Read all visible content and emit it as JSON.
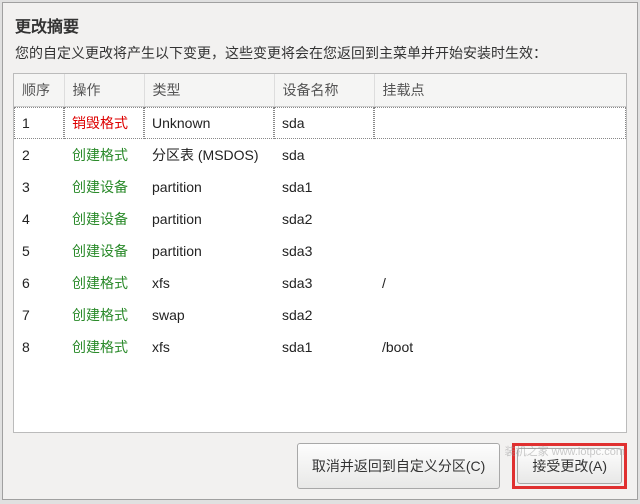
{
  "dialog": {
    "title": "更改摘要",
    "subtitle": "您的自定义更改将产生以下变更，这些变更将会在您返回到主菜单并开始安装时生效："
  },
  "table": {
    "headers": {
      "order": "顺序",
      "operation": "操作",
      "type": "类型",
      "device": "设备名称",
      "mount": "挂载点"
    },
    "rows": [
      {
        "order": "1",
        "op": "销毁格式",
        "op_class": "destroy",
        "type": "Unknown",
        "device": "sda",
        "mount": ""
      },
      {
        "order": "2",
        "op": "创建格式",
        "op_class": "create",
        "type": "分区表 (MSDOS)",
        "device": "sda",
        "mount": ""
      },
      {
        "order": "3",
        "op": "创建设备",
        "op_class": "create",
        "type": "partition",
        "device": "sda1",
        "mount": ""
      },
      {
        "order": "4",
        "op": "创建设备",
        "op_class": "create",
        "type": "partition",
        "device": "sda2",
        "mount": ""
      },
      {
        "order": "5",
        "op": "创建设备",
        "op_class": "create",
        "type": "partition",
        "device": "sda3",
        "mount": ""
      },
      {
        "order": "6",
        "op": "创建格式",
        "op_class": "create",
        "type": "xfs",
        "device": "sda3",
        "mount": "/"
      },
      {
        "order": "7",
        "op": "创建格式",
        "op_class": "create",
        "type": "swap",
        "device": "sda2",
        "mount": ""
      },
      {
        "order": "8",
        "op": "创建格式",
        "op_class": "create",
        "type": "xfs",
        "device": "sda1",
        "mount": "/boot"
      }
    ]
  },
  "buttons": {
    "cancel": "取消并返回到自定义分区(C)",
    "accept": "接受更改(A)"
  },
  "watermark": "装机之家 www.lotpc.com"
}
